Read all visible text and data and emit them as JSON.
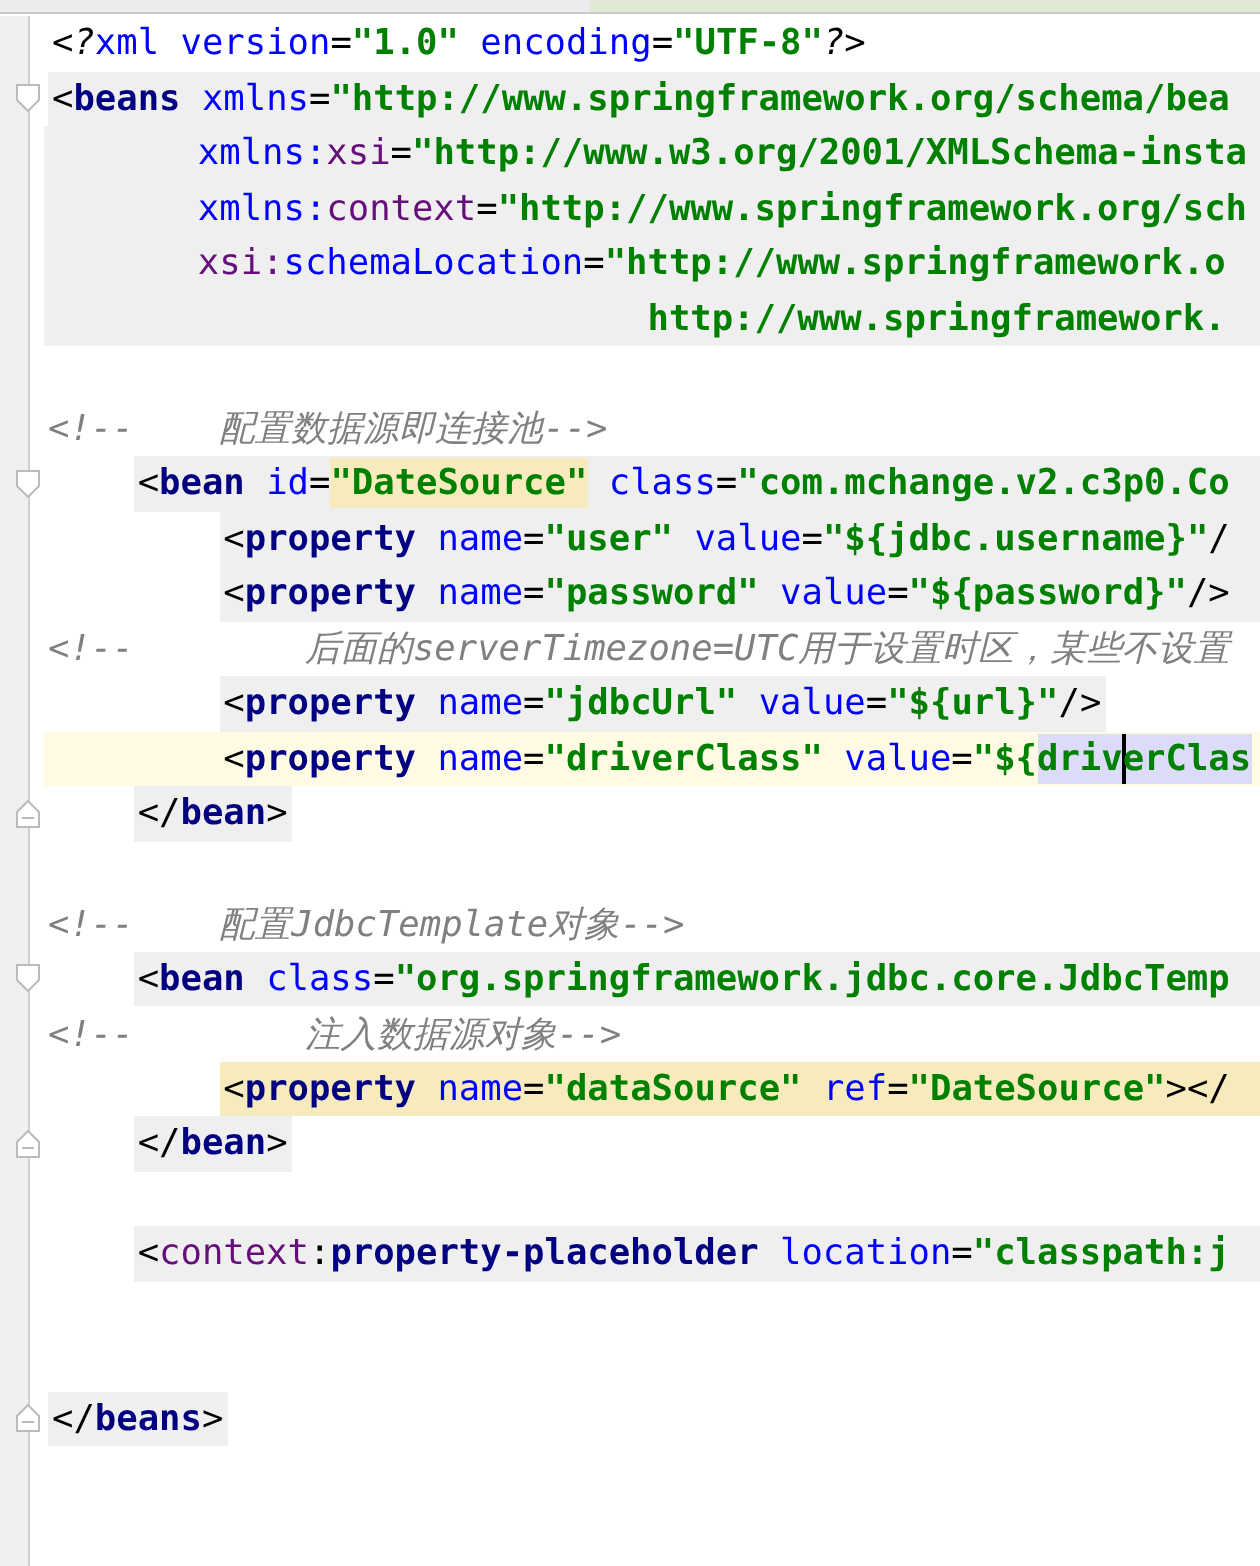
{
  "editor": {
    "lines": [
      {
        "kind": "root",
        "tokens": [
          {
            "kind": "pi",
            "text": "<?"
          },
          {
            "kind": "attr",
            "text": "xml"
          },
          {
            "kind": "attr",
            "text": " version"
          },
          {
            "kind": "punct",
            "text": "="
          },
          {
            "kind": "value",
            "text": "\"1.0\""
          },
          {
            "kind": "attr",
            "text": " encoding"
          },
          {
            "kind": "punct",
            "text": "="
          },
          {
            "kind": "value",
            "text": "\"UTF-8\""
          },
          {
            "kind": "pi",
            "text": "?>"
          }
        ]
      },
      {
        "kind": "root",
        "banded": true,
        "open_end": true,
        "fold_start": true,
        "tokens": [
          {
            "kind": "punct",
            "text": "<"
          },
          {
            "kind": "tag",
            "text": "beans"
          },
          {
            "kind": "attr",
            "text": " xmlns"
          },
          {
            "kind": "punct",
            "text": "="
          },
          {
            "kind": "value",
            "text": "\"http://www.springframework.org/schema/bea"
          }
        ]
      },
      {
        "kind": "continued",
        "banded": true,
        "open_end": true,
        "tokens": [
          {
            "kind": "attr",
            "text": "xmlns:"
          },
          {
            "kind": "ns",
            "text": "xsi"
          },
          {
            "kind": "punct",
            "text": "="
          },
          {
            "kind": "value",
            "text": "\"http://www.w3.org/2001/XMLSchema-insta"
          }
        ]
      },
      {
        "kind": "continued",
        "banded": true,
        "open_end": true,
        "tokens": [
          {
            "kind": "attr",
            "text": "xmlns:"
          },
          {
            "kind": "ns",
            "text": "context"
          },
          {
            "kind": "punct",
            "text": "="
          },
          {
            "kind": "value",
            "text": "\"http://www.springframework.org/sch"
          }
        ]
      },
      {
        "kind": "continued",
        "banded": true,
        "open_end": true,
        "tokens": [
          {
            "kind": "ns",
            "text": "xsi:"
          },
          {
            "kind": "attr",
            "text": "schemaLocation"
          },
          {
            "kind": "punct",
            "text": "="
          },
          {
            "kind": "value",
            "text": "\"http://www.springframework.o"
          }
        ]
      },
      {
        "kind": "wrapped",
        "banded": true,
        "open_end": true,
        "tokens": [
          {
            "kind": "value",
            "text": "http://www.springframework."
          }
        ]
      },
      {
        "kind": "blank"
      },
      {
        "kind": "comment",
        "text": "<!--    配置数据源即连接池-->"
      },
      {
        "kind": "child",
        "banded": true,
        "open_end": true,
        "fold_start": true,
        "tokens": [
          {
            "kind": "punct",
            "text": "<"
          },
          {
            "kind": "tag",
            "text": "bean"
          },
          {
            "kind": "attr",
            "text": " id"
          },
          {
            "kind": "punct",
            "text": "="
          },
          {
            "kind": "value",
            "text": "\"DateSource\"",
            "usage_mark": true
          },
          {
            "kind": "attr",
            "text": " class"
          },
          {
            "kind": "punct",
            "text": "="
          },
          {
            "kind": "value",
            "text": "\"com.mchange.v2.c3p0.Co"
          }
        ]
      },
      {
        "kind": "grandchild",
        "banded": true,
        "open_end": true,
        "tokens": [
          {
            "kind": "punct",
            "text": "<"
          },
          {
            "kind": "tag",
            "text": "property"
          },
          {
            "kind": "attr",
            "text": " name"
          },
          {
            "kind": "punct",
            "text": "="
          },
          {
            "kind": "value",
            "text": "\"user\""
          },
          {
            "kind": "attr",
            "text": " value"
          },
          {
            "kind": "punct",
            "text": "="
          },
          {
            "kind": "value",
            "text": "\"${jdbc.username}\""
          },
          {
            "kind": "punct",
            "text": "/"
          }
        ]
      },
      {
        "kind": "grandchild",
        "banded": true,
        "open_end": true,
        "tokens": [
          {
            "kind": "punct",
            "text": "<"
          },
          {
            "kind": "tag",
            "text": "property"
          },
          {
            "kind": "attr",
            "text": " name"
          },
          {
            "kind": "punct",
            "text": "="
          },
          {
            "kind": "value",
            "text": "\"password\""
          },
          {
            "kind": "attr",
            "text": " value"
          },
          {
            "kind": "punct",
            "text": "="
          },
          {
            "kind": "value",
            "text": "\"${password}\""
          },
          {
            "kind": "punct",
            "text": "/>"
          }
        ]
      },
      {
        "kind": "comment",
        "text": "<!--        后面的serverTimezone=UTC用于设置时区，某些不设置"
      },
      {
        "kind": "grandchild",
        "banded": true,
        "tokens": [
          {
            "kind": "punct",
            "text": "<"
          },
          {
            "kind": "tag",
            "text": "property"
          },
          {
            "kind": "attr",
            "text": " name"
          },
          {
            "kind": "punct",
            "text": "="
          },
          {
            "kind": "value",
            "text": "\"jdbcUrl\""
          },
          {
            "kind": "attr",
            "text": " value"
          },
          {
            "kind": "punct",
            "text": "="
          },
          {
            "kind": "value",
            "text": "\"${url}\""
          },
          {
            "kind": "punct",
            "text": "/>"
          }
        ]
      },
      {
        "kind": "grandchild",
        "current": true,
        "tokens": [
          {
            "kind": "punct",
            "text": "<"
          },
          {
            "kind": "tag",
            "text": "property"
          },
          {
            "kind": "attr",
            "text": " name"
          },
          {
            "kind": "punct",
            "text": "="
          },
          {
            "kind": "value",
            "text": "\"driverClass\""
          },
          {
            "kind": "attr",
            "text": " value"
          },
          {
            "kind": "punct",
            "text": "="
          },
          {
            "kind": "value",
            "text": "\"${"
          },
          {
            "kind": "value",
            "text": "driv",
            "selected": true
          },
          {
            "kind": "value",
            "text": "erClas",
            "selected": true,
            "caret_before": true
          }
        ]
      },
      {
        "kind": "child",
        "banded": true,
        "fold_end": true,
        "tokens": [
          {
            "kind": "punct",
            "text": "</"
          },
          {
            "kind": "tag",
            "text": "bean"
          },
          {
            "kind": "punct",
            "text": ">"
          }
        ]
      },
      {
        "kind": "blank"
      },
      {
        "kind": "comment",
        "text": "<!--    配置JdbcTemplate对象-->"
      },
      {
        "kind": "child",
        "banded": true,
        "open_end": true,
        "fold_start": true,
        "tokens": [
          {
            "kind": "punct",
            "text": "<"
          },
          {
            "kind": "tag",
            "text": "bean"
          },
          {
            "kind": "attr",
            "text": " class"
          },
          {
            "kind": "punct",
            "text": "="
          },
          {
            "kind": "value",
            "text": "\"org.springframework.jdbc.core.JdbcTemp"
          }
        ]
      },
      {
        "kind": "comment",
        "text": "<!--        注入数据源对象-->"
      },
      {
        "kind": "grandchild",
        "usage": true,
        "open_end": true,
        "tokens": [
          {
            "kind": "punct",
            "text": "<"
          },
          {
            "kind": "tag",
            "text": "property"
          },
          {
            "kind": "attr",
            "text": " name"
          },
          {
            "kind": "punct",
            "text": "="
          },
          {
            "kind": "value",
            "text": "\"dataSource\""
          },
          {
            "kind": "attr",
            "text": " ref"
          },
          {
            "kind": "punct",
            "text": "="
          },
          {
            "kind": "value",
            "text": "\"DateSource\""
          },
          {
            "kind": "punct",
            "text": "></"
          }
        ]
      },
      {
        "kind": "child",
        "banded": true,
        "fold_end": true,
        "tokens": [
          {
            "kind": "punct",
            "text": "</"
          },
          {
            "kind": "tag",
            "text": "bean"
          },
          {
            "kind": "punct",
            "text": ">"
          }
        ]
      },
      {
        "kind": "blank"
      },
      {
        "kind": "child",
        "banded": true,
        "open_end": true,
        "tokens": [
          {
            "kind": "punct",
            "text": "<"
          },
          {
            "kind": "ns",
            "text": "context"
          },
          {
            "kind": "punct",
            "text": ":"
          },
          {
            "kind": "tag",
            "text": "property-placeholder"
          },
          {
            "kind": "attr",
            "text": " location"
          },
          {
            "kind": "punct",
            "text": "="
          },
          {
            "kind": "value",
            "text": "\"classpath:j"
          }
        ]
      },
      {
        "kind": "blank"
      },
      {
        "kind": "blank"
      },
      {
        "kind": "root",
        "banded": true,
        "fold_end": true,
        "tokens": [
          {
            "kind": "punct",
            "text": "</"
          },
          {
            "kind": "tag",
            "text": "beans"
          },
          {
            "kind": "punct",
            "text": ">"
          }
        ]
      }
    ]
  }
}
